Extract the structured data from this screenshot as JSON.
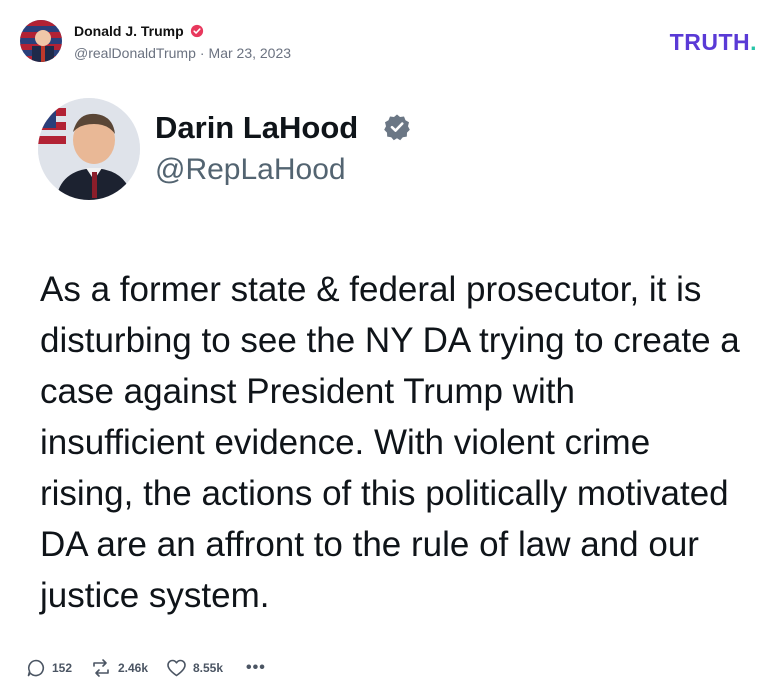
{
  "post": {
    "author_name": "Donald J. Trump",
    "author_handle": "@realDonaldTrump",
    "date": "Mar 23, 2023",
    "separator": "·",
    "verified_icon": "verified-badge-icon",
    "brand_logo_text": "TRUTH",
    "brand_logo_period": "."
  },
  "quoted": {
    "name": "Darin LaHood",
    "handle": "@RepLaHood",
    "verified_icon": "verified-badge-icon",
    "text": "As a former state & federal prosecutor, it is disturbing to see the NY DA trying to create a case against President Trump with insufficient evidence. With violent crime rising, the actions of this politically motivated DA are an affront to the rule of law and our justice system."
  },
  "actions": {
    "replies": "152",
    "retruths": "2.46k",
    "likes": "8.55k",
    "more": "•••"
  },
  "colors": {
    "brand_purple": "#5a3ad6",
    "brand_teal": "#27c5a8",
    "verified_red": "#e8385d",
    "verified_gray": "#6b7785",
    "muted_text": "#6b7280"
  }
}
